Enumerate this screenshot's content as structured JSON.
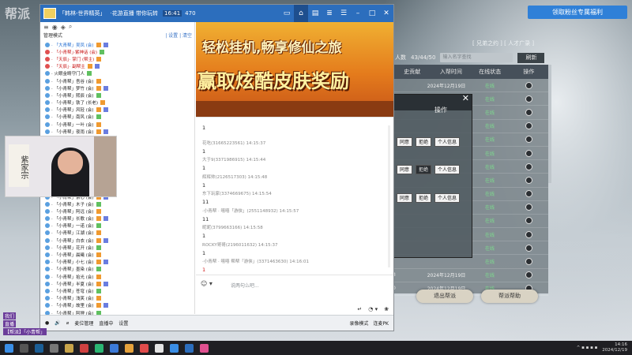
{
  "background": {
    "title_glyphs": "帮派"
  },
  "welfare_button": "领取粉丝专属福利",
  "game": {
    "top_text": "[ 兄弟之约 ] [ 人才广录 ]",
    "count_label": "人数",
    "count_value": "43/44/50",
    "search_placeholder": "输入名字查找",
    "refresh_label": "刷新",
    "columns": [
      "史贡献",
      "入帮时间",
      "在线状态",
      "操作"
    ],
    "rows": [
      {
        "contrib": "",
        "date": "2024年12月19日",
        "status": "在线"
      },
      {
        "contrib": "",
        "date": "",
        "status": "在线"
      },
      {
        "contrib": "",
        "date": "",
        "status": "在线"
      },
      {
        "contrib": "",
        "date": "",
        "status": "在线"
      },
      {
        "contrib": "",
        "date": "",
        "status": "在线"
      },
      {
        "contrib": "",
        "date": "",
        "status": "在线"
      },
      {
        "contrib": "",
        "date": "",
        "status": "在线"
      },
      {
        "contrib": "",
        "date": "",
        "status": "在线"
      },
      {
        "contrib": "",
        "date": "",
        "status": "在线"
      },
      {
        "contrib": "",
        "date": "",
        "status": "在线"
      },
      {
        "contrib": "",
        "date": "",
        "status": "在线"
      },
      {
        "contrib": "",
        "date": "",
        "status": "在线"
      },
      {
        "contrib": "",
        "date": "",
        "status": "在线"
      },
      {
        "contrib": "",
        "date": "",
        "status": "在线"
      },
      {
        "contrib": "3",
        "date": "2024年12月19日",
        "status": "在线"
      },
      {
        "contrib": "0",
        "date": "2024年12月19日",
        "status": "在线"
      }
    ],
    "exit_label": "退出帮派",
    "help_label": "帮派帮助",
    "dialog": {
      "header": "操作",
      "rows": [
        [
          "同意",
          "拒绝",
          "个人信息"
        ],
        [
          "同意",
          "拒绝",
          "个人信息"
        ],
        [
          "同意",
          "拒绝",
          "个人信息"
        ]
      ]
    }
  },
  "chat": {
    "title": "「韩林-世界精英」",
    "subtitle": "·花游直播 带你玩转",
    "badge": "16:41",
    "user_count": "470",
    "mode_label": "管理模式",
    "mode_links": "| 设置 | 清空",
    "placeholder": "说两句么吧...",
    "bottom": {
      "items": [
        "音量",
        "麦位管理",
        "直播中",
        "观看人数",
        "设置"
      ],
      "right": [
        "录像模式",
        "连麦PK"
      ]
    },
    "members": [
      {
        "name": "· 「大青帮」吴凤 (会)",
        "kind": "blue"
      },
      {
        "name": "· 「小青帮」·紫神话 (会)",
        "kind": "red"
      },
      {
        "name": "· 「天辰」· 掌门 (帮主)",
        "kind": "red"
      },
      {
        "name": "· 「天辰」· 副帮主",
        "kind": "red"
      },
      {
        "name": "· 火眼金睛守门人",
        "kind": ""
      },
      {
        "name": "· 「小青帮」吾谷 (会)",
        "kind": ""
      },
      {
        "name": "· 「小青帮」梦竹 (会)",
        "kind": ""
      },
      {
        "name": "· 「小青帮」熙辰 (会)",
        "kind": ""
      },
      {
        "name": "· 「小青帮」铁了 (长老)",
        "kind": ""
      },
      {
        "name": "· 「小青帮」风轻 (会)",
        "kind": ""
      },
      {
        "name": "· 「小青帮」南风 (会)",
        "kind": ""
      },
      {
        "name": "· 「小青帮」一叶 (会)",
        "kind": ""
      },
      {
        "name": "· 「小青帮」夜雨 (会)",
        "kind": ""
      },
      {
        "name": "· 「小青帮」小鱼 (会)",
        "kind": ""
      },
      {
        "name": "· 「小青帮」青石 (会)",
        "kind": ""
      },
      {
        "name": "· 「小青帮」云朵 (会)",
        "kind": ""
      },
      {
        "name": "· 「小青帮」星辰 (会)",
        "kind": ""
      },
      {
        "name": "· 「小青帮」不二 (会)",
        "kind": ""
      },
      {
        "name": "· 「小青帮」清风 (会)",
        "kind": ""
      },
      {
        "name": "· 「小青帮」落叶 (会)",
        "kind": ""
      },
      {
        "name": "· 「小青帮」北辰 (会)",
        "kind": ""
      },
      {
        "name": "· 「小青帮」素心 (会)",
        "kind": ""
      },
      {
        "name": "· 「小青帮」木子 (会)",
        "kind": ""
      },
      {
        "name": "· 「小青帮」阿远 (会)",
        "kind": ""
      },
      {
        "name": "· 「小青帮」长歌 (会)",
        "kind": ""
      },
      {
        "name": "· 「小青帮」一诺 (会)",
        "kind": ""
      },
      {
        "name": "· 「小青帮」江湖 (会)",
        "kind": ""
      },
      {
        "name": "· 「小青帮」白衣 (会)",
        "kind": ""
      },
      {
        "name": "· 「小青帮」花开 (会)",
        "kind": ""
      },
      {
        "name": "· 「小青帮」晨曦 (会)",
        "kind": ""
      },
      {
        "name": "· 「小青帮」小七 (会)",
        "kind": ""
      },
      {
        "name": "· 「小青帮」墨染 (会)",
        "kind": ""
      },
      {
        "name": "· 「小青帮」拾光 (会)",
        "kind": ""
      },
      {
        "name": "· 「小青帮」半夏 (会)",
        "kind": ""
      },
      {
        "name": "· 「小青帮」苍穹 (会)",
        "kind": ""
      },
      {
        "name": "· 「小青帮」浅笑 (会)",
        "kind": ""
      },
      {
        "name": "· 「小青帮」故里 (会)",
        "kind": ""
      },
      {
        "name": "· 「小青帮」阿狸 (会)",
        "kind": ""
      }
    ],
    "banner": {
      "line1": "轻松挂机,畅享修仙之旅",
      "line2": "赢取炫酷皮肤奖励"
    },
    "messages": [
      {
        "who": "",
        "body": "1",
        "red": false
      },
      {
        "who": "花吃(31665223561) 14:15:37",
        "body": "1",
        "red": false
      },
      {
        "who": "大于9(3371986915) 14:15:44",
        "body": "1",
        "red": false
      },
      {
        "who": "辉辉帅(2126517303) 14:15:48",
        "body": "1",
        "red": false
      },
      {
        "who": "东下玩家(3374669675) 14:15:54",
        "body": "11",
        "red": false
      },
      {
        "who": "·小青帮 · 嘻嘻「游侠」(2551148932) 14:15:57",
        "body": "11",
        "red": false
      },
      {
        "who": "昵昵(3799663166) 14:15:58",
        "body": "1",
        "red": false
      },
      {
        "who": "ROCKY哥哥(2196011632) 14:15:37",
        "body": "1",
        "red": false
      },
      {
        "who": "·小青帮 · 嘻嘻 帮帮「游侠」(3371463630) 14:16:01",
        "body": "1",
        "red": true
      }
    ]
  },
  "pip": {
    "calligraphy": "紫家宗"
  },
  "left_labels": [
    "我们",
    "直播",
    "【帮派】「小青帮」"
  ],
  "tray": {
    "time": "14:16",
    "date": "2024/12/19"
  },
  "colors": {
    "accent": "#2c6ebd",
    "welfare": "#2f80d8",
    "online": "#7ddc8e"
  }
}
